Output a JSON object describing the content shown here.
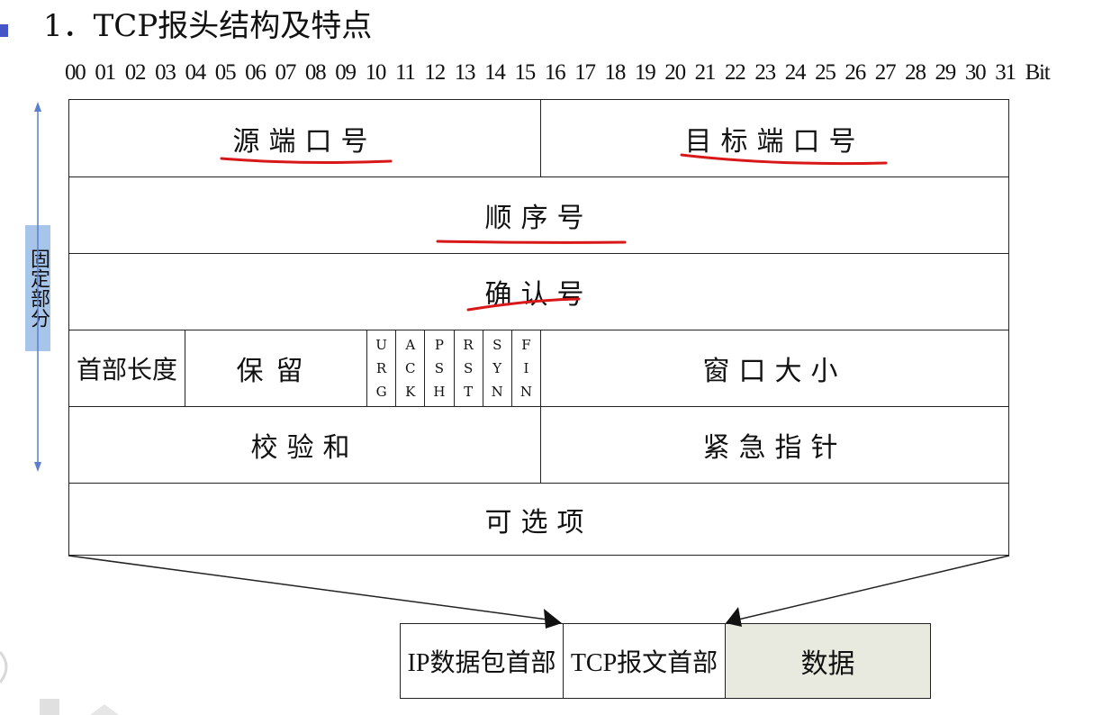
{
  "title": "1．TCP报头结构及特点",
  "bit_ruler": {
    "numbers": [
      "00",
      "01",
      "02",
      "03",
      "04",
      "05",
      "06",
      "07",
      "08",
      "09",
      "10",
      "11",
      "12",
      "13",
      "14",
      "15",
      "16",
      "17",
      "18",
      "19",
      "20",
      "21",
      "22",
      "23",
      "24",
      "25",
      "26",
      "27",
      "28",
      "29",
      "30",
      "31"
    ],
    "unit": "Bit"
  },
  "fixed_label": "固定部分",
  "header_rows": {
    "row1": {
      "source_port": "源端口号",
      "dest_port": "目标端口号"
    },
    "row2": {
      "sequence_number": "顺序号"
    },
    "row3": {
      "ack_number": "确认号"
    },
    "row4": {
      "header_length": "首部长度",
      "reserved": "保留",
      "flags": [
        "URG",
        "ACK",
        "PSH",
        "RST",
        "SYN",
        "FIN"
      ],
      "window_size": "窗口大小"
    },
    "row5": {
      "checksum": "校验和",
      "urgent_pointer": "紧急指针"
    },
    "row6": {
      "options": "可选项"
    }
  },
  "packet": {
    "ip_header": "IP数据包首部",
    "tcp_header": "TCP报文首部",
    "data": "数据"
  },
  "colors": {
    "fixed_label_bg": "#a6c5e9",
    "data_cell_bg": "#e8eadf",
    "annotation_red": "#d81818",
    "bullet": "#4455c8",
    "arrow_blue": "#5b7ecf"
  }
}
